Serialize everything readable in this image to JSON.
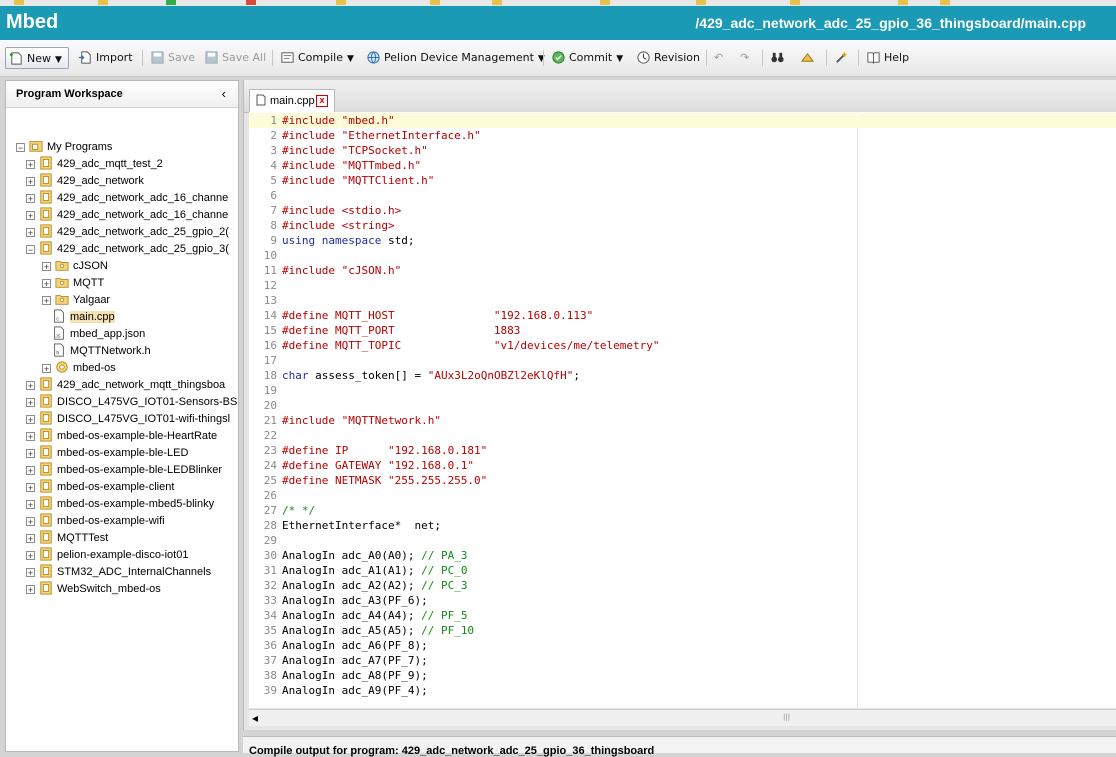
{
  "app": {
    "logo": "Mbed",
    "path": "/429_adc_network_adc_25_gpio_36_thingsboard/main.cpp"
  },
  "toolbar": {
    "new": "New",
    "import": "Import",
    "save": "Save",
    "save_all": "Save All",
    "compile": "Compile",
    "pelion": "Pelion Device Management",
    "commit": "Commit",
    "revision": "Revision",
    "help": "Help"
  },
  "workspace": {
    "title": "Program Workspace",
    "collapse_glyph": "‹",
    "root": "My Programs",
    "items": [
      "429_adc_mqtt_test_2",
      "429_adc_network",
      "429_adc_network_adc_16_channe",
      "429_adc_network_adc_16_channe",
      "429_adc_network_adc_25_gpio_2(",
      "429_adc_network_adc_25_gpio_3(",
      "cJSON",
      "MQTT",
      "Yalgaar",
      "main.cpp",
      "mbed_app.json",
      "MQTTNetwork.h",
      "mbed-os",
      "429_adc_network_mqtt_thingsboa",
      "DISCO_L475VG_IOT01-Sensors-BS",
      "DISCO_L475VG_IOT01-wifi-thingsl",
      "mbed-os-example-ble-HeartRate",
      "mbed-os-example-ble-LED",
      "mbed-os-example-ble-LEDBlinker",
      "mbed-os-example-client",
      "mbed-os-example-mbed5-blinky",
      "mbed-os-example-wifi",
      "MQTTTest",
      "pelion-example-disco-iot01",
      "STM32_ADC_InternalChannels",
      "WebSwitch_mbed-os"
    ]
  },
  "editor": {
    "tab": "main.cpp",
    "tab_close": "x",
    "lines": [
      {
        "n": "1",
        "code": "#include \"mbed.h\""
      },
      {
        "n": "2",
        "code": "#include \"EthernetInterface.h\""
      },
      {
        "n": "3",
        "code": "#include \"TCPSocket.h\""
      },
      {
        "n": "4",
        "code": "#include \"MQTTmbed.h\""
      },
      {
        "n": "5",
        "code": "#include \"MQTTClient.h\""
      },
      {
        "n": "6",
        "code": ""
      },
      {
        "n": "7",
        "code": "#include <stdio.h>"
      },
      {
        "n": "8",
        "code": "#include <string>"
      },
      {
        "n": "9",
        "code": "using namespace std;"
      },
      {
        "n": "10",
        "code": ""
      },
      {
        "n": "11",
        "code": "#include \"cJSON.h\""
      },
      {
        "n": "12",
        "code": ""
      },
      {
        "n": "13",
        "code": ""
      },
      {
        "n": "14",
        "code": "#define MQTT_HOST               \"192.168.0.113\""
      },
      {
        "n": "15",
        "code": "#define MQTT_PORT               1883"
      },
      {
        "n": "16",
        "code": "#define MQTT_TOPIC              \"v1/devices/me/telemetry\""
      },
      {
        "n": "17",
        "code": ""
      },
      {
        "n": "18",
        "code": "char assess_token[] = \"AUx3L2oQnOBZl2eKlQfH\";"
      },
      {
        "n": "19",
        "code": ""
      },
      {
        "n": "20",
        "code": ""
      },
      {
        "n": "21",
        "code": "#include \"MQTTNetwork.h\""
      },
      {
        "n": "22",
        "code": ""
      },
      {
        "n": "23",
        "code": "#define IP      \"192.168.0.181\""
      },
      {
        "n": "24",
        "code": "#define GATEWAY \"192.168.0.1\""
      },
      {
        "n": "25",
        "code": "#define NETMASK \"255.255.255.0\""
      },
      {
        "n": "26",
        "code": ""
      },
      {
        "n": "27",
        "code": "/* */"
      },
      {
        "n": "28",
        "code": "EthernetInterface*  net;"
      },
      {
        "n": "29",
        "code": ""
      },
      {
        "n": "30",
        "code": "AnalogIn adc_A0(A0); // PA_3"
      },
      {
        "n": "31",
        "code": "AnalogIn adc_A1(A1); // PC_0"
      },
      {
        "n": "32",
        "code": "AnalogIn adc_A2(A2); // PC_3"
      },
      {
        "n": "33",
        "code": "AnalogIn adc_A3(PF_6);"
      },
      {
        "n": "34",
        "code": "AnalogIn adc_A4(A4); // PF_5"
      },
      {
        "n": "35",
        "code": "AnalogIn adc_A5(A5); // PF_10"
      },
      {
        "n": "36",
        "code": "AnalogIn adc_A6(PF_8);"
      },
      {
        "n": "37",
        "code": "AnalogIn adc_A7(PF_7);"
      },
      {
        "n": "38",
        "code": "AnalogIn adc_A8(PF_9);"
      },
      {
        "n": "39",
        "code": "AnalogIn adc_A9(PF_4);"
      }
    ]
  },
  "output": {
    "title": "Compile output for program: 429_adc_network_adc_25_gpio_36_thingsboard"
  }
}
